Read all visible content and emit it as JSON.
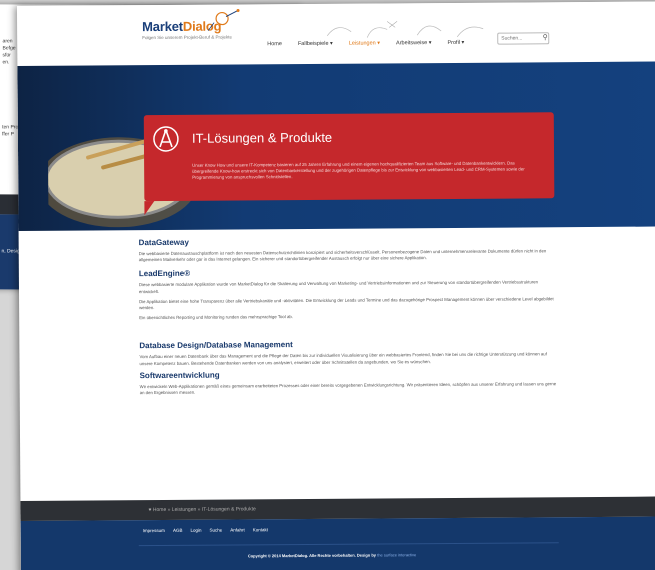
{
  "background_page": {
    "text_top": "aren\nBefge\nsfür\nen.",
    "text_mid": "ten Proz\nffer P",
    "text_bottom": "n, Desig"
  },
  "header": {
    "logo_main": "Market",
    "logo_accent": "Dialog",
    "tagline": "Folgen Sie unserem Projekt-Beruf & Projekte",
    "nav": [
      {
        "label": "Home",
        "active": false
      },
      {
        "label": "Fallbeispiele ▾",
        "active": false
      },
      {
        "label": "Leistungen ▾",
        "active": true
      },
      {
        "label": "Arbeitsweise ▾",
        "active": false
      },
      {
        "label": "Profil ▾",
        "active": false
      }
    ],
    "search_placeholder": "Suchen..."
  },
  "banner": {
    "title": "IT-Lösungen & Produkte",
    "text": "Unser Know How und unsere IT-Kompetenz basieren auf 25 Jahren Erfahrung und einem eigenen hochqualifizierten Team aus Software- und Datenbankentwicklern. Das übergreifende Know-how erstreckt sich von Datenbankerstellung und der zugehörigen Datenpflege bis zur Entwicklung von webbasierten Lead- und CRM-Systemen sowie der Programmierung von anspruchsvollen Schnittstellen."
  },
  "sections": [
    {
      "title": "DataGateway",
      "paragraphs": [
        "Die webbasierte Datenaustauschplattform ist nach den neuesten Datenschutzrichtlinien konzipiert und sicherheitsverschlüsselt. Personenbezogene Daten und unternehmensrelevante Dokumente dürfen nicht in den allgemeinen Mailverkehr oder gar in das Internet gelangen. Ein sicherer und standortübergreifender Austausch erfolgt nur über eine sichere Applikation."
      ]
    },
    {
      "title": "LeadEngine®",
      "paragraphs": [
        "Diese webbasierte modulare Applikation wurde von MarketDialog für die Skalierung und Verwaltung von Marketing- und Vertriebsinformationen und zur Steuerung von standortübergreifenden Vertriebsstrukturen entwickelt.",
        "Die Applikation bietet eine hohe Transparenz über alle Vertriebskanäle und -aktivitäten. Die Entwicklung der Leads und Termine und das dazugehörige Prospect Management können über verschiedene Level abgebildet werden.",
        "Ein übersichtliches Reporting und Monitoring runden das mehrsprachige Tool ab."
      ]
    },
    {
      "title": "Database Design/Database Management",
      "paragraphs": [
        "Vom Aufbau einer neuen Datenbank über das Management und die Pflege der Daten bis zur individuellen Visualisierung über ein webbasiertes Frontend, finden Sie bei uns die richtige Unterstützung und können auf unsere Kompetenz bauen. Bestehende Datenbanken werden von uns analysiert, erweitert oder über Schnittstellen da angebunden, wo Sie es wünschen."
      ]
    },
    {
      "title": "Softwareentwicklung",
      "paragraphs": [
        "Wir entwickeln Web-Applikationen gemäß eines gemeinsam erarbeiteten Prozesses oder einer bereits vorgegebenen Entwicklungsrichtung. Wir präsentieren Ideen, schöpfen aus unserer Erfahrung und lassen uns gerne an den Ergebnissen messen."
      ]
    }
  ],
  "breadcrumb": {
    "home": "Home",
    "sep": "»",
    "level1": "Leistungen",
    "level2": "IT-Lösungen & Produkte"
  },
  "footer": {
    "links": [
      "Impressum",
      "AGB",
      "Login",
      "Suche",
      "Anfahrt",
      "Kontakt"
    ],
    "copyright": "Copyright © 2014 MarketDialog. Alle Rechte vorbehalten. Design by",
    "designer": "the surface interactive"
  },
  "colors": {
    "brand_blue": "#1a3a6c",
    "accent_orange": "#e07a1a",
    "banner_red": "#c5282c",
    "footer_dark": "#2d3035"
  }
}
